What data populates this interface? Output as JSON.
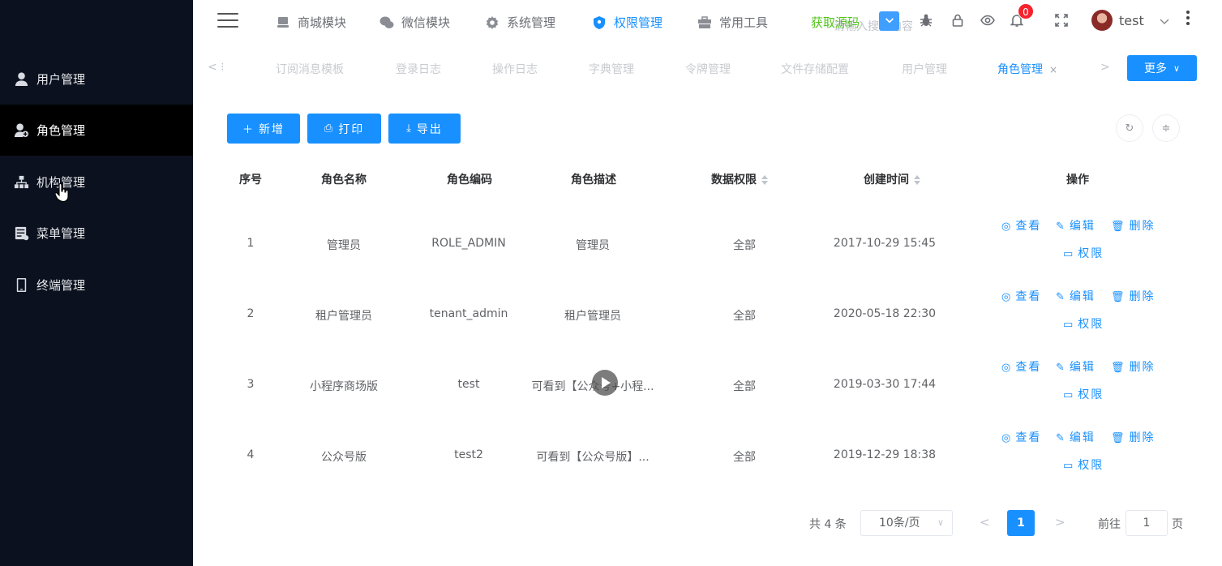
{
  "sidebar": {
    "items": [
      {
        "label": "用户管理",
        "icon": "user-icon"
      },
      {
        "label": "角色管理",
        "icon": "role-icon",
        "active": true
      },
      {
        "label": "机构管理",
        "icon": "org-tree-icon"
      },
      {
        "label": "菜单管理",
        "icon": "menu-icon"
      },
      {
        "label": "终端管理",
        "icon": "terminal-icon"
      }
    ]
  },
  "topbar": {
    "nav": [
      {
        "label": "商城模块",
        "icon": "shop-icon"
      },
      {
        "label": "微信模块",
        "icon": "wechat-icon"
      },
      {
        "label": "系统管理",
        "icon": "gear-icon"
      },
      {
        "label": "权限管理",
        "icon": "shield-icon",
        "active": true
      },
      {
        "label": "常用工具",
        "icon": "toolbox-icon"
      }
    ],
    "get_source": "获取源码",
    "search_placeholder": "请输入搜索内容",
    "notification_count": "0",
    "user_name": "test"
  },
  "tabs": {
    "items": [
      {
        "label": "订阅消息模板"
      },
      {
        "label": "登录日志"
      },
      {
        "label": "操作日志"
      },
      {
        "label": "字典管理"
      },
      {
        "label": "令牌管理"
      },
      {
        "label": "文件存储配置"
      },
      {
        "label": "用户管理"
      },
      {
        "label": "角色管理",
        "active": true
      }
    ],
    "close_glyph": "×",
    "more_label": "更多"
  },
  "toolbar": {
    "add_label": "新增",
    "print_label": "打印",
    "export_label": "导出"
  },
  "table": {
    "headers": [
      "序号",
      "角色名称",
      "角色编码",
      "角色描述",
      "数据权限",
      "创建时间",
      "操作"
    ],
    "rows": [
      {
        "index": "1",
        "name": "管理员",
        "code": "ROLE_ADMIN",
        "desc": "管理员",
        "scope": "全部",
        "created": "2017-10-29 15:45"
      },
      {
        "index": "2",
        "name": "租户管理员",
        "code": "tenant_admin",
        "desc": "租户管理员",
        "scope": "全部",
        "created": "2020-05-18 22:30"
      },
      {
        "index": "3",
        "name": "小程序商场版",
        "code": "test",
        "desc": "可看到【公众号+小程...",
        "scope": "全部",
        "created": "2019-03-30 17:44"
      },
      {
        "index": "4",
        "name": "公众号版",
        "code": "test2",
        "desc": "可看到【公众号版】...",
        "scope": "全部",
        "created": "2019-12-29 18:38"
      }
    ],
    "ops": {
      "view": "查看",
      "edit": "编辑",
      "delete": "删除",
      "perm": "权限"
    }
  },
  "pagination": {
    "total": "共 4 条",
    "page_size": "10条/页",
    "current": "1",
    "goto_label": "前往",
    "goto_value": "1",
    "page_suffix": "页"
  },
  "colors": {
    "primary": "#1890ff",
    "sidebar_bg": "#0b111e",
    "source_green": "#52c41a",
    "badge_red": "#f5222d"
  }
}
